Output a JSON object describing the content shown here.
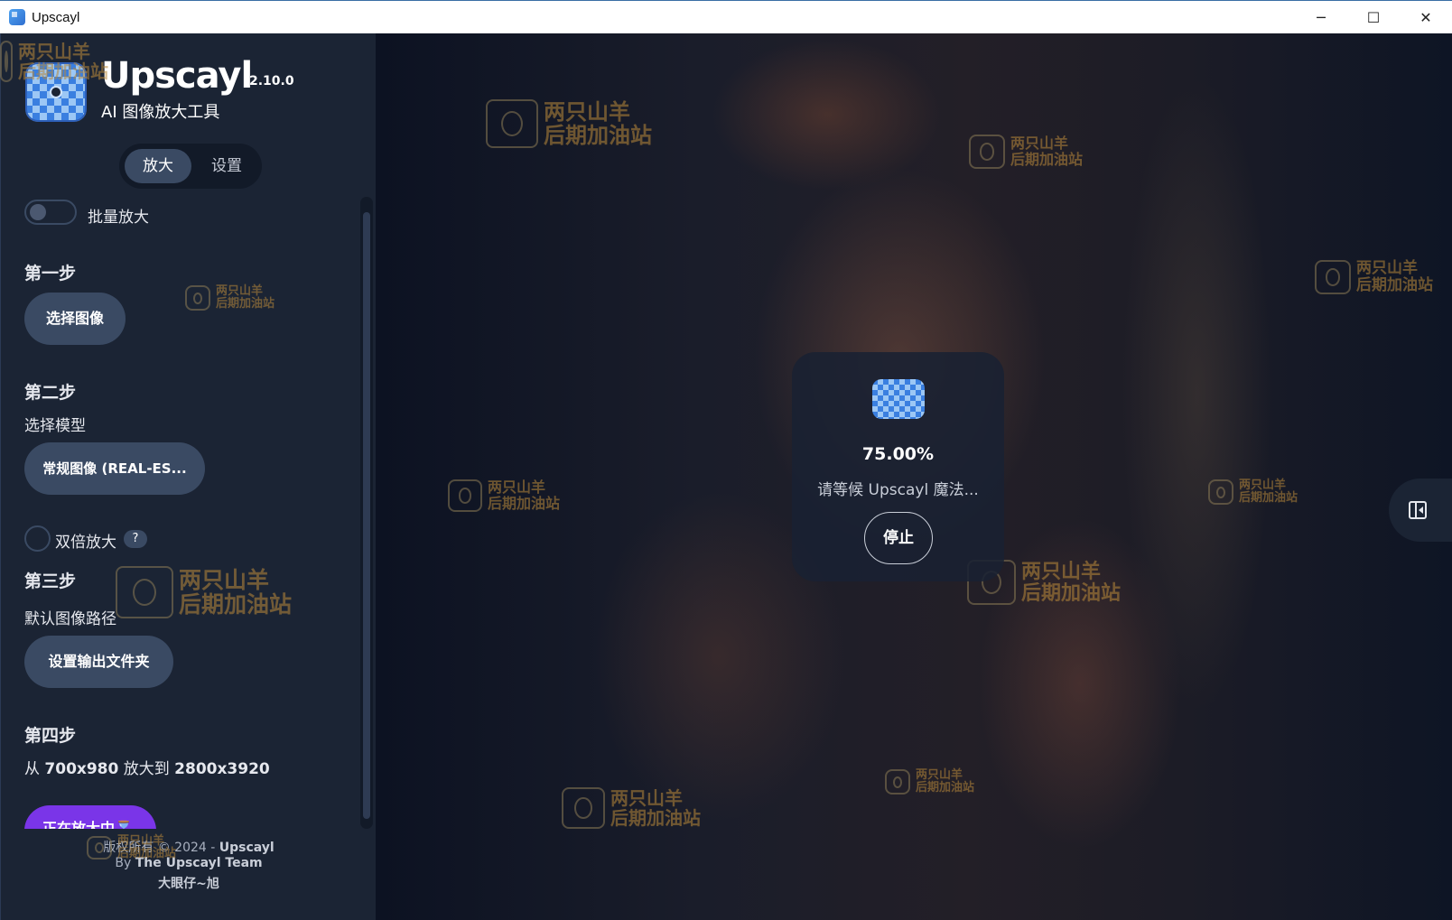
{
  "window": {
    "title": "Upscayl",
    "controls": [
      "─",
      "☐",
      "✕"
    ]
  },
  "sidebar": {
    "app_name": "Upscayl",
    "version": "2.10.0",
    "subtitle": "AI 图像放大工具",
    "tabs": [
      {
        "label": "放大",
        "active": true
      },
      {
        "label": "设置",
        "active": false
      }
    ],
    "batch_label": "批量放大",
    "batch_enabled": false,
    "step1": {
      "title": "第一步",
      "button": "选择图像"
    },
    "step2": {
      "title": "第二步",
      "subtitle": "选择模型",
      "button": "常规图像 (REAL-ES...",
      "double_label": "双倍放大",
      "help": "?"
    },
    "step3": {
      "title": "第三步",
      "subtitle": "默认图像路径",
      "button": "设置输出文件夹"
    },
    "step4": {
      "title": "第四步",
      "from_label": "从",
      "from_size": "700x980",
      "to_label": "放大到",
      "to_size": "2800x3920",
      "button": "正在放大中",
      "button_icon": "hourglass-icon"
    },
    "footer": {
      "copyright": "版权所有 © 2024 -",
      "brand": "Upscayl",
      "by": "By",
      "team": "The Upscayl Team",
      "credit": "大眼仔~旭"
    }
  },
  "progress": {
    "percent": "75.00%",
    "message": "请等候 Upscayl 魔法...",
    "stop_label": "停止"
  },
  "watermark": {
    "line1": "两只山羊",
    "line2": "后期加油站"
  },
  "colors": {
    "sidebar_bg": "#1b2434",
    "accent_purple": "#7a35e8",
    "pill_bg": "#3a4a63",
    "watermark_gold": "#b9893a"
  }
}
